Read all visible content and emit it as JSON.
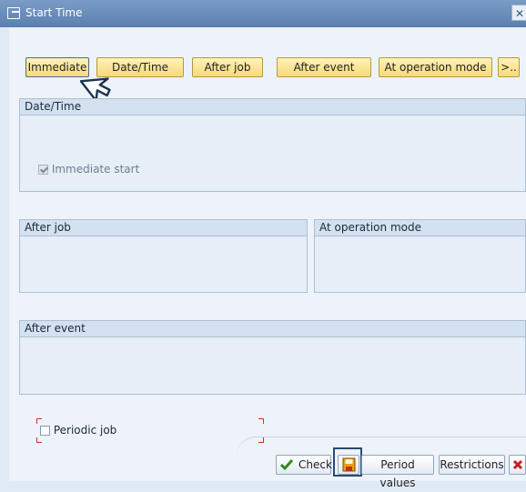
{
  "window": {
    "title": "Start Time",
    "close_glyph": "✕"
  },
  "toolbar": {
    "immediate": "Immediate",
    "date_time": "Date/Time",
    "after_job": "After job",
    "after_event": "After event",
    "at_operation_mode": "At operation mode",
    "more": ">.."
  },
  "groups": {
    "date_time": {
      "title": "Date/Time",
      "immediate_start_label": "Immediate start",
      "immediate_start_checked": true
    },
    "after_job": {
      "title": "After job"
    },
    "at_operation_mode": {
      "title": "At operation mode"
    },
    "after_event": {
      "title": "After event"
    }
  },
  "periodic_job": {
    "label": "Periodic job",
    "checked": false
  },
  "footer": {
    "check": "Check",
    "period_values": "Period values",
    "restrictions": "Restrictions"
  },
  "icons": [
    "window-icon",
    "close-icon",
    "mouse-cursor-icon",
    "checkmark-icon",
    "save-icon",
    "cancel-icon"
  ],
  "colors": {
    "titlebar": "#5b7fae",
    "button_yellow": "#f7d978",
    "background": "#eef3fa",
    "group_header": "#d4e1f0",
    "bracket_red": "#d03020"
  }
}
